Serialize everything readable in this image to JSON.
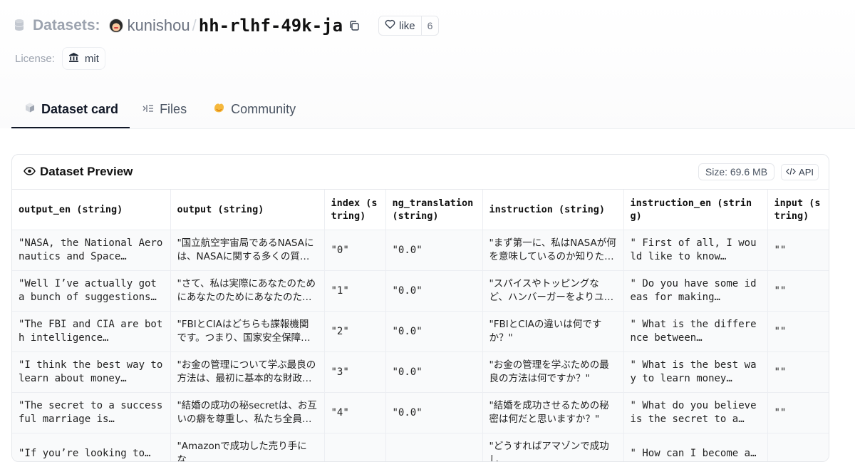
{
  "header": {
    "section_label": "Datasets:",
    "owner": "kunishou",
    "separator": "/",
    "repo_name": "hh-rlhf-49k-ja",
    "like_label": "like",
    "like_count": "6",
    "license_label": "License:",
    "license_value": "mit"
  },
  "tabs": [
    {
      "label": "Dataset card",
      "icon": "cube-icon",
      "active": true
    },
    {
      "label": "Files",
      "icon": "files-icon",
      "active": false
    },
    {
      "label": "Community",
      "icon": "community-icon",
      "active": false
    }
  ],
  "preview": {
    "title": "Dataset Preview",
    "size": "Size: 69.6 MB",
    "api_label": "API",
    "columns": [
      {
        "name": "output_en (string)"
      },
      {
        "name": "output (string)"
      },
      {
        "name": "index (string)"
      },
      {
        "name": "ng_translation (string)"
      },
      {
        "name": "instruction (string)"
      },
      {
        "name": "instruction_en (string)"
      },
      {
        "name": "input (string)"
      }
    ],
    "rows": [
      [
        "\"NASA, the National Aeronautics and Space…",
        "\"国立航空宇宙局であるNASAには、NASAに関する多くの質問に…",
        "\"0\"",
        "\"0.0\"",
        "\"まず第一に、私はNASAが何を意味しているのか知りたい…",
        "\" First of all, I would like to know…",
        "\"\""
      ],
      [
        "\"Well I’ve actually got a bunch of suggestions…",
        "\"さて、私は実際にあなたのためにあなたのためにあなたのため…",
        "\"1\"",
        "\"0.0\"",
        "\"スパイスやトッピングなど、ハンバーガーをよりユニーク…",
        "\" Do you have some ideas for making…",
        "\"\""
      ],
      [
        "\"The FBI and CIA are both intelligence…",
        "\"FBIとCIAはどちらも諜報機関です。つまり、国家安全保障の…",
        "\"2\"",
        "\"0.0\"",
        "\"FBIとCIAの違いは何ですか？\"",
        "\" What is the difference between…",
        "\"\""
      ],
      [
        "\"I think the best way to learn about money…",
        "\"お金の管理について学ぶ最良の方法は、最初に基本的な財政を…",
        "\"3\"",
        "\"0.0\"",
        "\"お金の管理を学ぶための最良の方法は何ですか？\"",
        "\" What is the best way to learn money…",
        "\"\""
      ],
      [
        "\"The secret to a successful marriage is…",
        "\"結婚の成功の秘secretは、お互いの癖を尊重し、私たち全員…",
        "\"4\"",
        "\"0.0\"",
        "\"結婚を成功させるための秘密は何だと思いますか？\"",
        "\" What do you believe is the secret to a…",
        "\"\""
      ],
      [
        "\"If you’re looking to…",
        "\"Amazonで成功した売り手にな…",
        "",
        "",
        "\"どうすればアマゾンで成功し…",
        "\" How can I become a…",
        ""
      ]
    ]
  },
  "colors": {
    "text_primary": "#111827",
    "text_muted": "#9ca3af",
    "border": "#e5e7eb",
    "cell_bg": "#f9fafb",
    "community_icon": "#f5b83d"
  }
}
